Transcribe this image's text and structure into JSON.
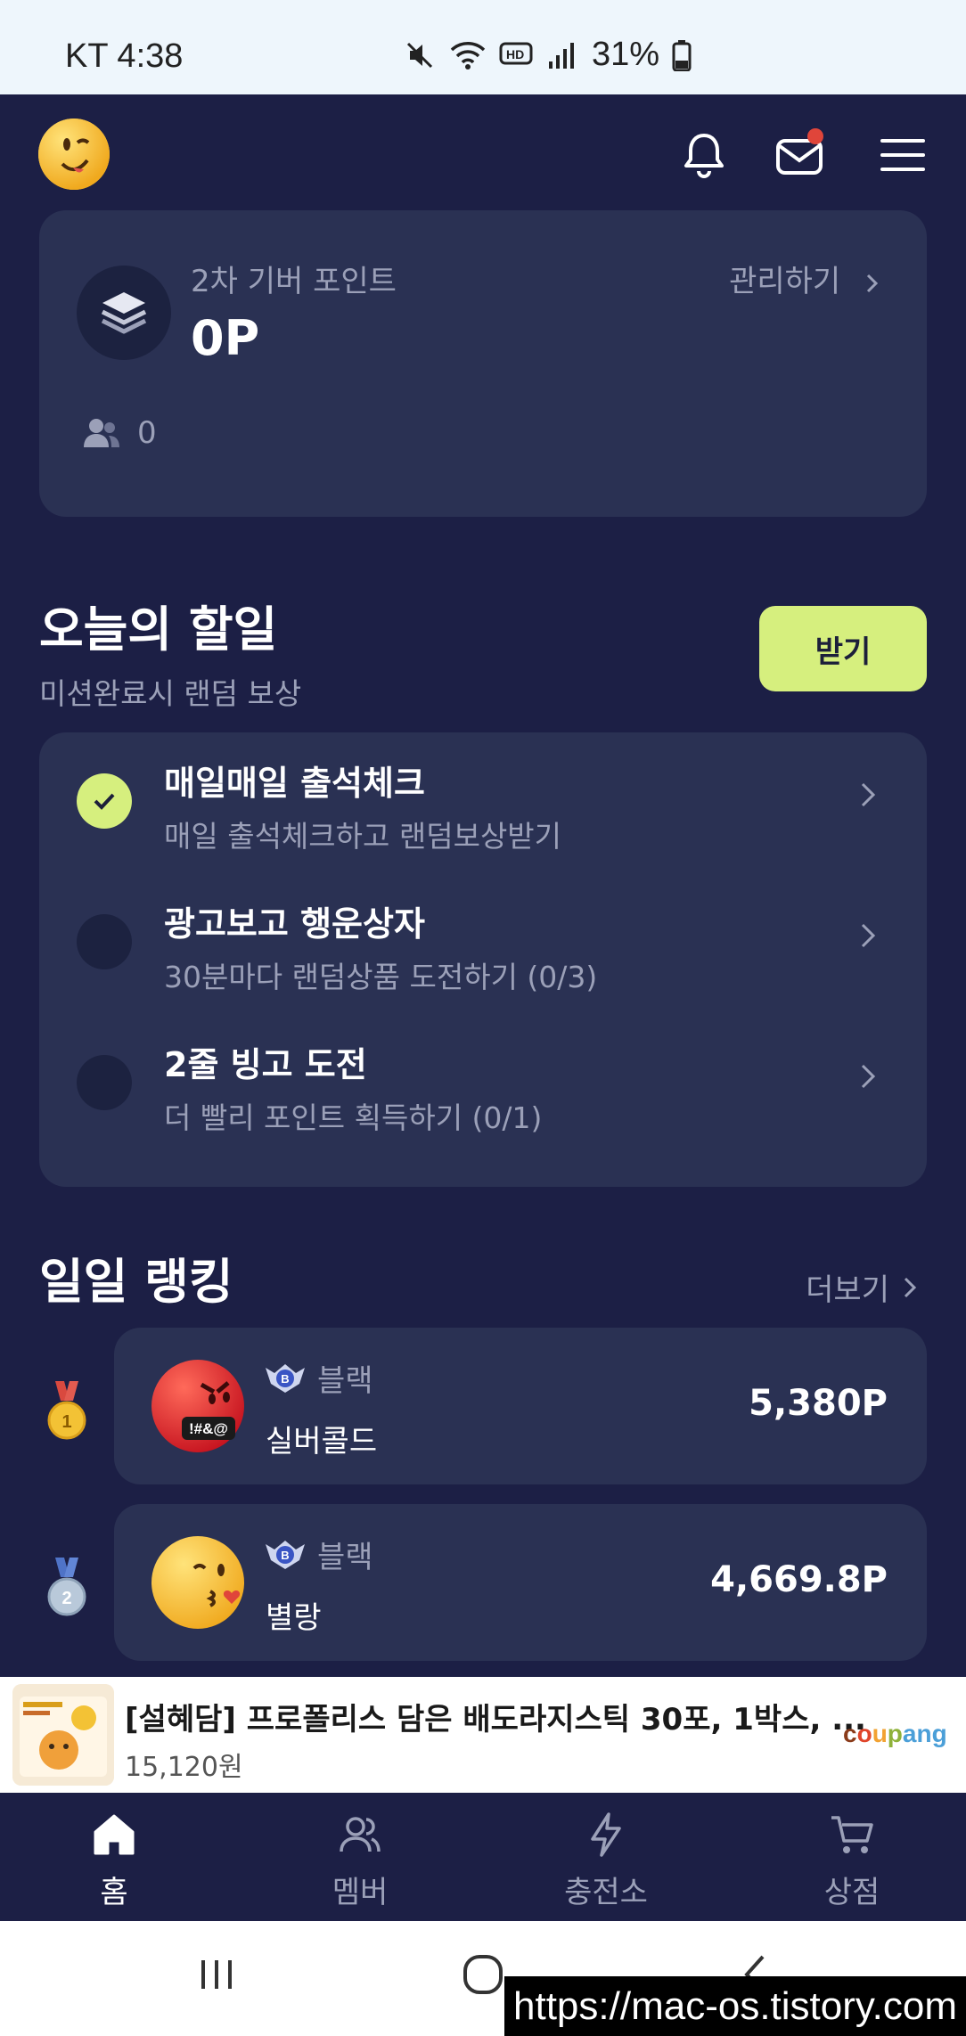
{
  "status_bar": {
    "carrier_time": "KT 4:38",
    "battery": "31%"
  },
  "points_card": {
    "label": "2차 기버 포인트",
    "value": "0P",
    "manage": "관리하기",
    "member_count": "0"
  },
  "today": {
    "title": "오늘의 할일",
    "subtitle": "미션완료시 랜덤 보상",
    "receive_button": "받기",
    "tasks": [
      {
        "title": "매일매일 출석체크",
        "desc": "매일 출석체크하고 랜덤보상받기",
        "done": true
      },
      {
        "title": "광고보고 행운상자",
        "desc": "30분마다 랜덤상품 도전하기 (0/3)",
        "done": false
      },
      {
        "title": "2줄 빙고 도전",
        "desc": "더 빨리 포인트 획득하기 (0/1)",
        "done": false
      }
    ]
  },
  "ranking": {
    "title": "일일 랭킹",
    "more": "더보기",
    "rows": [
      {
        "rank": "1",
        "tier": "블랙",
        "tier_badge": "B",
        "nickname": "실버콜드",
        "points": "5,380P",
        "face_text": "!#&@"
      },
      {
        "rank": "2",
        "tier": "블랙",
        "tier_badge": "B",
        "nickname": "별랑",
        "points": "4,669.8P"
      }
    ]
  },
  "ad": {
    "title": "[설혜담] 프로폴리스 담은 배도라지스틱 30포, 1박스, ...",
    "price": "15,120원",
    "brand": "coupang"
  },
  "bottom_nav": [
    {
      "label": "홈",
      "icon": "home-icon",
      "active": true
    },
    {
      "label": "멤버",
      "icon": "members-icon",
      "active": false
    },
    {
      "label": "충전소",
      "icon": "lightning-icon",
      "active": false
    },
    {
      "label": "상점",
      "icon": "cart-icon",
      "active": false
    }
  ],
  "watermark": "https://mac-os.tistory.com",
  "colors": {
    "background": "#1c1f45",
    "card": "#2a3153",
    "accent": "#d6ef7e",
    "muted_text": "#9ba0b8",
    "notification_dot": "#e0453a"
  }
}
